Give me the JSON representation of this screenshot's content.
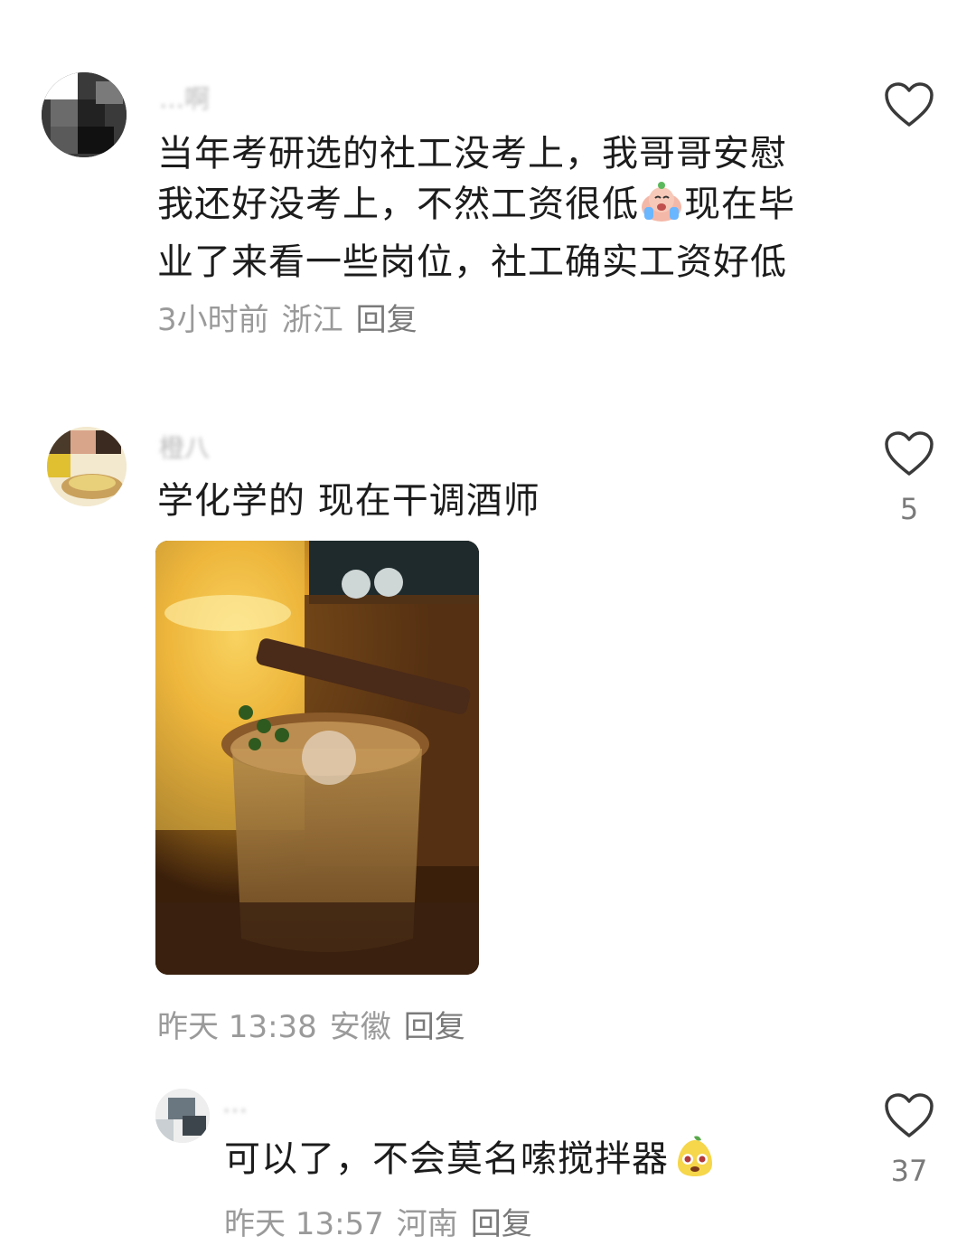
{
  "comments": [
    {
      "username": "…啊",
      "text_line1": "当年考研选的社工没考上，我哥哥安慰",
      "text_line2a": "我还好没考上，不然工资很低",
      "text_line2b": "现在毕",
      "text_line3": "业了来看一些岗位，社工确实工资好低",
      "emoji": "crying-face",
      "time": "3小时前",
      "region": "浙江",
      "reply_label": "回复",
      "likes": ""
    },
    {
      "username": "橙八",
      "text": "学化学的 现在干调酒师",
      "image_desc": "cocktail-photo",
      "time": "昨天 13:38",
      "region": "安徽",
      "reply_label": "回复",
      "likes": "5"
    },
    {
      "username": "…",
      "text": "可以了，不会莫名嗦搅拌器",
      "emoji": "pear-face",
      "time": "昨天 13:57",
      "region": "河南",
      "reply_label": "回复",
      "likes": "37"
    }
  ],
  "icons": {
    "like": "heart-outline-icon"
  },
  "colors": {
    "meta": "#9a9a9a",
    "text": "#1c1c1c"
  }
}
